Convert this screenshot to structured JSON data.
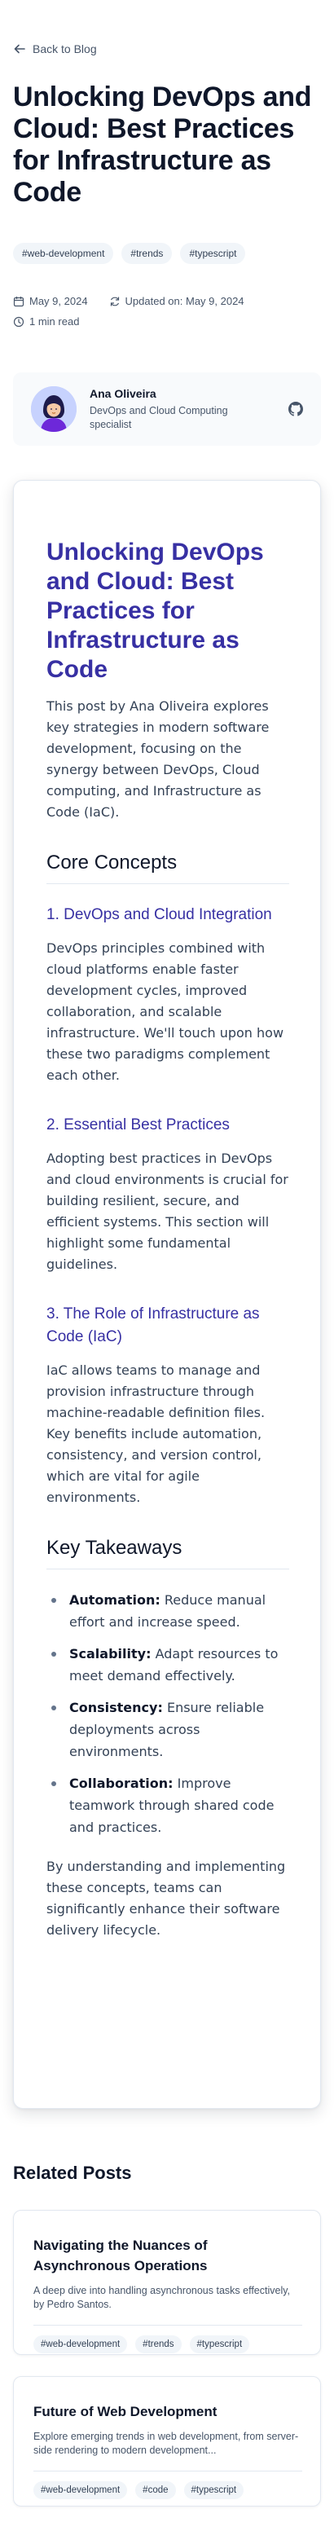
{
  "nav": {
    "back_label": "Back to Blog"
  },
  "post": {
    "title": "Unlocking DevOps and Cloud: Best Practices for Infrastructure as Code",
    "tags": [
      "#web-development",
      "#trends",
      "#typescript"
    ],
    "date": "May 9, 2024",
    "updated": "Updated on: May 9, 2024",
    "read_time": "1 min read"
  },
  "author": {
    "name": "Ana Oliveira",
    "role": "DevOps and Cloud Computing specialist"
  },
  "article": {
    "title": "Unlocking DevOps and Cloud: Best Practices for Infrastructure as Code",
    "intro": "This post by Ana Oliveira explores key strategies in modern software development, focusing on the synergy between DevOps, Cloud computing, and Infrastructure as Code (IaC).",
    "core_heading": "Core Concepts",
    "sections": [
      {
        "heading": "1. DevOps and Cloud Integration",
        "body": "DevOps principles combined with cloud platforms enable faster development cycles, improved collaboration, and scalable infrastructure. We'll touch upon how these two paradigms complement each other."
      },
      {
        "heading": "2. Essential Best Practices",
        "body": "Adopting best practices in DevOps and cloud environments is crucial for building resilient, secure, and efficient systems. This section will highlight some fundamental guidelines."
      },
      {
        "heading": "3. The Role of Infrastructure as Code (IaC)",
        "body": "IaC allows teams to manage and provision infrastructure through machine-readable definition files. Key benefits include automation, consistency, and version control, which are vital for agile environments."
      }
    ],
    "takeaways_heading": "Key Takeaways",
    "takeaways": [
      {
        "term": "Automation:",
        "text": "Reduce manual effort and increase speed."
      },
      {
        "term": "Scalability:",
        "text": "Adapt resources to meet demand effectively."
      },
      {
        "term": "Consistency:",
        "text": "Ensure reliable deployments across environments."
      },
      {
        "term": "Collaboration:",
        "text": "Improve teamwork through shared code and practices."
      }
    ],
    "conclusion": "By understanding and implementing these concepts, teams can significantly enhance their software delivery lifecycle."
  },
  "related": {
    "heading": "Related Posts",
    "posts": [
      {
        "title": "Navigating the Nuances of Asynchronous Operations",
        "desc": "A deep dive into handling asynchronous tasks effectively, by Pedro Santos.",
        "tags": [
          "#web-development",
          "#trends",
          "#typescript"
        ]
      },
      {
        "title": "Future of Web Development",
        "desc": "Explore emerging trends in web development, from server-side rendering to modern development...",
        "tags": [
          "#web-development",
          "#code",
          "#typescript"
        ]
      }
    ]
  },
  "icons": {
    "back": "arrow-left-icon",
    "date": "calendar-icon",
    "updated": "refresh-icon",
    "read_time": "clock-icon",
    "github": "github-icon"
  },
  "colors": {
    "accent": "#3730a3",
    "text": "#0f172a",
    "muted": "#475569",
    "tag_bg": "#f1f5f9"
  }
}
